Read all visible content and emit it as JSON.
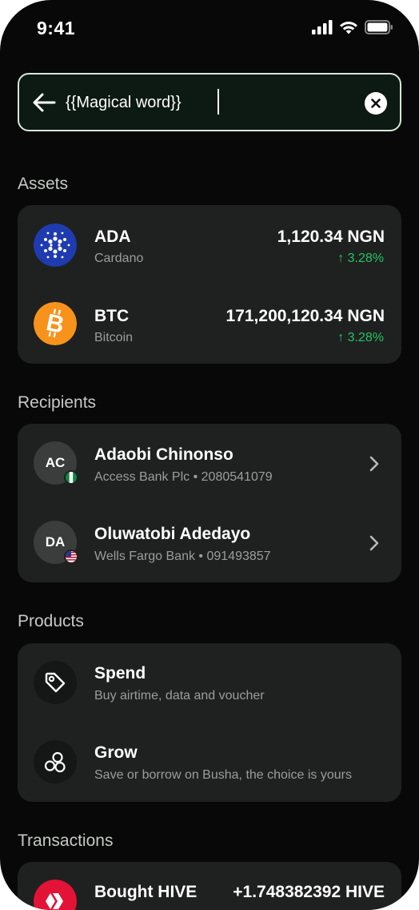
{
  "status_bar": {
    "time": "9:41"
  },
  "search": {
    "query": "{{Magical word}}"
  },
  "sections": {
    "assets": "Assets",
    "recipients": "Recipients",
    "products": "Products",
    "transactions": "Transactions"
  },
  "assets": [
    {
      "symbol": "ADA",
      "name": "Cardano",
      "amount": "1,120.34 NGN",
      "change": "↑ 3.28%",
      "icon": "cardano-icon",
      "color": "#1f3bb0"
    },
    {
      "symbol": "BTC",
      "name": "Bitcoin",
      "amount": "171,200,120.34 NGN",
      "change": "↑ 3.28%",
      "icon": "bitcoin-icon",
      "color": "#f7931a"
    }
  ],
  "recipients": [
    {
      "initials": "AC",
      "name": "Adaobi Chinonso",
      "detail": "Access Bank Plc • 2080541079",
      "flag": "nigeria-flag-icon"
    },
    {
      "initials": "DA",
      "name": "Oluwatobi Adedayo",
      "detail": "Wells Fargo Bank • 091493857",
      "flag": "usa-flag-icon"
    }
  ],
  "products": [
    {
      "title": "Spend",
      "subtitle": "Buy airtime, data and voucher",
      "icon": "tag-icon"
    },
    {
      "title": "Grow",
      "subtitle": "Save or borrow on Busha, the choice is yours",
      "icon": "coins-icon"
    }
  ],
  "transactions": [
    {
      "title": "Bought HIVE",
      "amount": "+1.748382392 HIVE",
      "icon": "hive-icon",
      "color": "#e31337"
    }
  ],
  "colors": {
    "background": "#070807",
    "card": "#1e211f",
    "positive": "#25c463",
    "search_border": "#d8e6d8"
  }
}
